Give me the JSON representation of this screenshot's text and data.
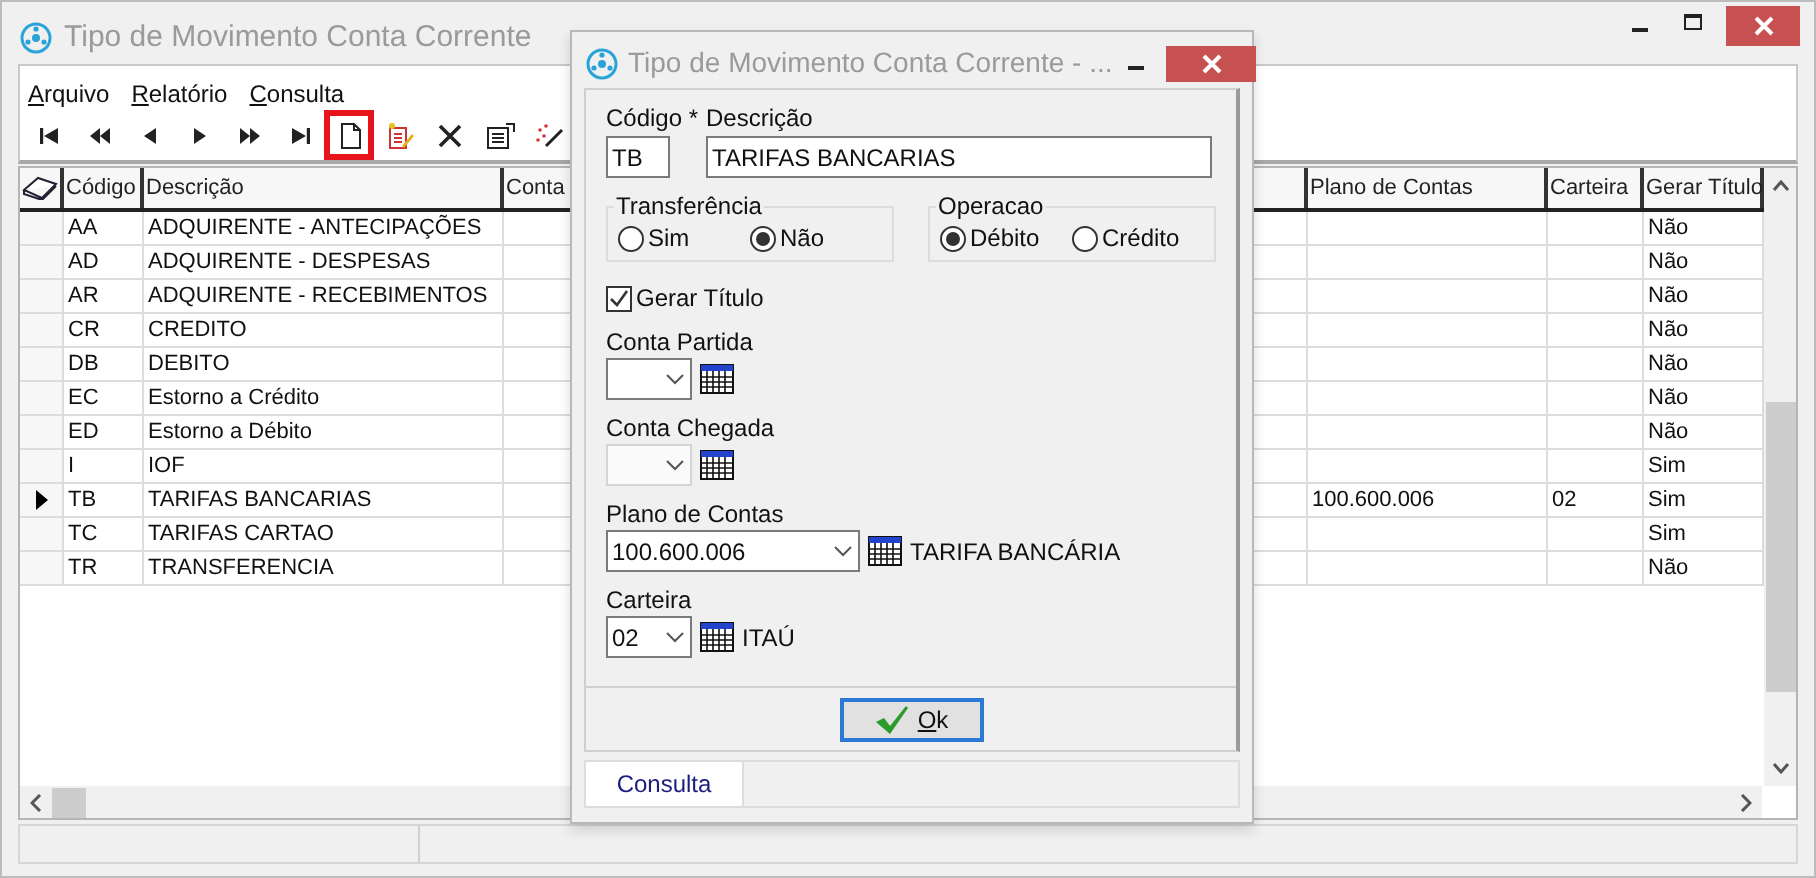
{
  "main_window": {
    "title": "Tipo de Movimento Conta Corrente",
    "menu": [
      {
        "label": "Arquivo"
      },
      {
        "label": "Relatório"
      },
      {
        "label": "Consulta"
      }
    ],
    "toolbar": [
      {
        "kind": "first",
        "highlighted": false
      },
      {
        "kind": "prior_page",
        "highlighted": false
      },
      {
        "kind": "prior",
        "highlighted": false
      },
      {
        "kind": "next",
        "highlighted": false
      },
      {
        "kind": "next_page",
        "highlighted": false
      },
      {
        "kind": "last",
        "highlighted": false
      },
      {
        "kind": "new",
        "highlighted": true
      },
      {
        "kind": "edit",
        "highlighted": false
      },
      {
        "kind": "delete",
        "highlighted": false
      },
      {
        "kind": "properties",
        "highlighted": false
      },
      {
        "kind": "wand",
        "highlighted": false
      }
    ],
    "table": {
      "columns": [
        {
          "label": "Código"
        },
        {
          "label": "Descrição"
        },
        {
          "label": "Conta"
        },
        {
          "label": "Plano de Contas"
        },
        {
          "label": "Carteira"
        },
        {
          "label": "Gerar Título"
        }
      ],
      "rows": [
        {
          "selected": false,
          "codigo": "AA",
          "descricao": "ADQUIRENTE - ANTECIPAÇÕES",
          "gerar_titulo": "Não"
        },
        {
          "selected": false,
          "codigo": "AD",
          "descricao": "ADQUIRENTE - DESPESAS",
          "gerar_titulo": "Não"
        },
        {
          "selected": false,
          "codigo": "AR",
          "descricao": "ADQUIRENTE - RECEBIMENTOS",
          "gerar_titulo": "Não"
        },
        {
          "selected": false,
          "codigo": "CR",
          "descricao": "CREDITO",
          "gerar_titulo": "Não"
        },
        {
          "selected": false,
          "codigo": "DB",
          "descricao": "DEBITO",
          "gerar_titulo": "Não"
        },
        {
          "selected": false,
          "codigo": "EC",
          "descricao": "Estorno a Crédito",
          "gerar_titulo": "Não"
        },
        {
          "selected": false,
          "codigo": "ED",
          "descricao": "Estorno a Débito",
          "gerar_titulo": "Não"
        },
        {
          "selected": false,
          "codigo": "I",
          "descricao": "IOF",
          "gerar_titulo": "Sim"
        },
        {
          "selected": true,
          "codigo": "TB",
          "descricao": "TARIFAS BANCARIAS",
          "plano_de_contas": "100.600.006",
          "carteira": "02",
          "gerar_titulo": "Sim"
        },
        {
          "selected": false,
          "codigo": "TC",
          "descricao": "TARIFAS CARTAO",
          "gerar_titulo": "Sim"
        },
        {
          "selected": false,
          "codigo": "TR",
          "descricao": "TRANSFERENCIA",
          "gerar_titulo": "Não"
        }
      ]
    }
  },
  "dialog": {
    "title": "Tipo de Movimento Conta Corrente - ...",
    "codigo": {
      "label": "Código *",
      "value": "TB"
    },
    "descricao": {
      "label": "Descrição",
      "value": "TARIFAS BANCARIAS"
    },
    "groups": [
      {
        "legend": "Transferência",
        "options": [
          {
            "label": "Sim",
            "selected": false
          },
          {
            "label": "Não",
            "selected": true
          }
        ]
      },
      {
        "legend": "Operacao",
        "options": [
          {
            "label": "Débito",
            "selected": true
          },
          {
            "label": "Crédito",
            "selected": false
          }
        ]
      }
    ],
    "gerar_titulo": {
      "label": "Gerar Título",
      "checked": true
    },
    "lookups": [
      {
        "label": "Conta Partida",
        "disabled": false
      },
      {
        "label": "Conta Chegada",
        "disabled": true
      },
      {
        "label": "Plano de Contas",
        "value": "100.600.006",
        "description": "TARIFA BANCÁRIA",
        "disabled": false
      },
      {
        "label": "Carteira",
        "value": "02",
        "description": "ITAÚ",
        "disabled": false
      }
    ],
    "ok_button": {
      "label": "Ok"
    },
    "tabs": [
      {
        "label": "Consulta",
        "selected": true
      }
    ]
  }
}
